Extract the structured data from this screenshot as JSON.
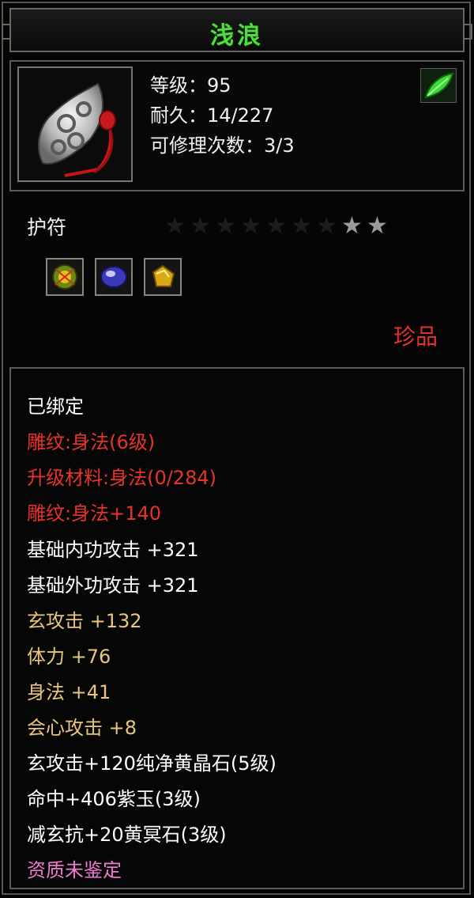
{
  "item": {
    "name": "浅浪",
    "level_line": "等级：95",
    "durability_line": "耐久：14/227",
    "repair_line": "可修理次数：3/3",
    "category": "护符",
    "rarity": "珍品",
    "stars": {
      "total": 9,
      "lit": 2
    }
  },
  "gems": [
    {
      "name": "yellow-green-gem-icon",
      "color": "#c8b020"
    },
    {
      "name": "purple-gem-icon",
      "color": "#5a5ad8"
    },
    {
      "name": "golden-gem-icon",
      "color": "#e0b020"
    }
  ],
  "attributes": [
    {
      "text": "已绑定",
      "color": "white"
    },
    {
      "text": "雕纹:身法(6级)",
      "color": "red"
    },
    {
      "text": "升级材料:身法(0/284)",
      "color": "red"
    },
    {
      "text": "雕纹:身法+140",
      "color": "red"
    },
    {
      "text": "基础内功攻击 +321",
      "color": "white"
    },
    {
      "text": "基础外功攻击 +321",
      "color": "white"
    },
    {
      "text": "玄攻击 +132",
      "color": "gold"
    },
    {
      "text": "体力 +76",
      "color": "gold"
    },
    {
      "text": "身法 +41",
      "color": "gold"
    },
    {
      "text": "会心攻击 +8",
      "color": "gold"
    },
    {
      "text": "玄攻击+120纯净黄晶石(5级)",
      "color": "white"
    },
    {
      "text": "命中+406紫玉(3级)",
      "color": "white"
    },
    {
      "text": "减玄抗+20黄冥石(3级)",
      "color": "white"
    },
    {
      "text": "资质未鉴定",
      "color": "pink"
    }
  ],
  "colors": {
    "title": "#4fdc3c",
    "rarity": "#e4312c",
    "red_attr": "#e8332b",
    "gold_attr": "#e8c77a",
    "pink_attr": "#f07ad2"
  }
}
